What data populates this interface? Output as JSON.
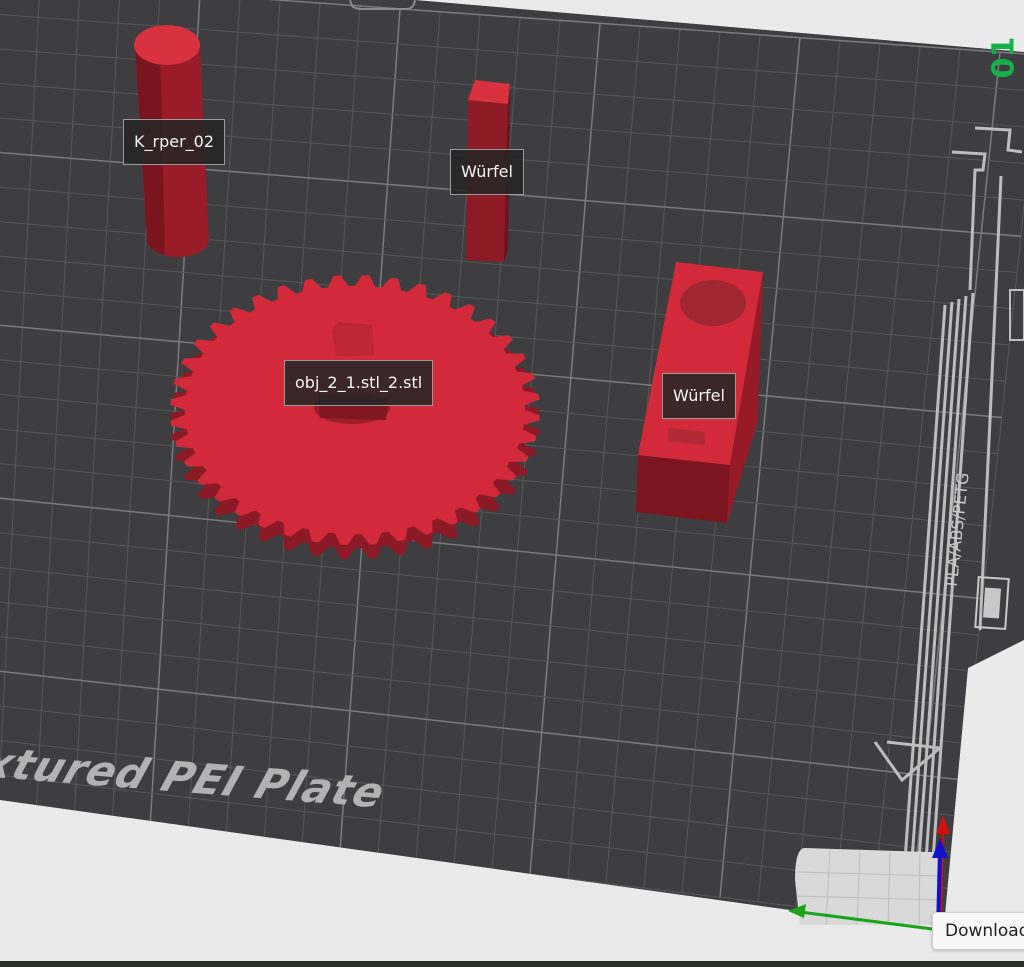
{
  "plate": {
    "number": "01",
    "plate_name_text": "xtured PEI Plate",
    "filament_text": "PLA/ABS/PETG"
  },
  "objects": [
    {
      "label": "K_rper_02",
      "kind": "cylinder"
    },
    {
      "label": "Würfel",
      "kind": "tall-box"
    },
    {
      "label": "obj_2_1.stl_2.stl",
      "kind": "gear"
    },
    {
      "label": "Würfel",
      "kind": "box"
    }
  ],
  "tooltip": {
    "text": "Download"
  },
  "colors": {
    "plate": "#3e3e40",
    "grid": "#5c5c5e",
    "object_red": "#d22a3a",
    "axis_x": "#1aa41a",
    "axis_y": "#cc1111",
    "axis_z": "#1111cc",
    "plate_number": "#16b04a"
  }
}
